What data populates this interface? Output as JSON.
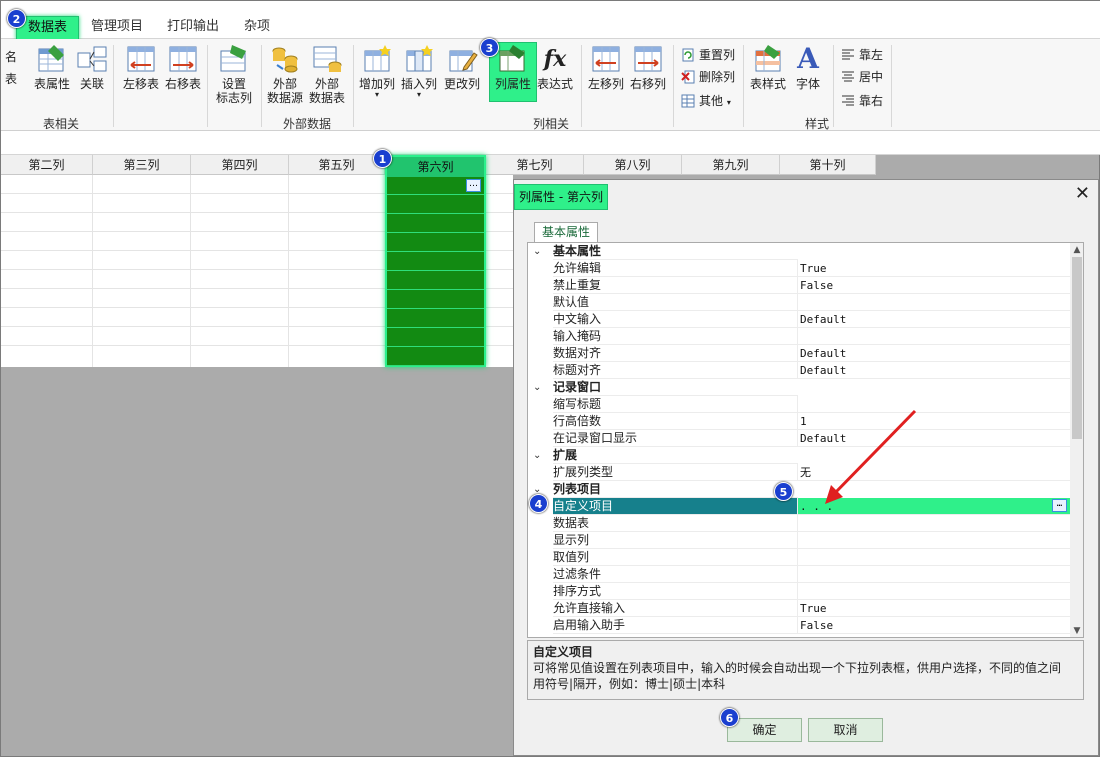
{
  "ribbon_tabs": [
    "数据表",
    "管理项目",
    "打印输出",
    "杂项"
  ],
  "left_partial": [
    "名",
    "表"
  ],
  "groups": {
    "table": "表相关",
    "external": "外部数据",
    "column": "列相关",
    "style": "样式"
  },
  "buttons": {
    "table_props": "表属性",
    "relation": "关联",
    "move_left": "左移表",
    "move_right": "右移表",
    "set_flag_line1": "设置",
    "set_flag_line2": "标志列",
    "ext_source_line1": "外部",
    "ext_source_line2": "数据源",
    "ext_table_line1": "外部",
    "ext_table_line2": "数据表",
    "add_col": "增加列",
    "insert_col": "插入列",
    "change_col": "更改列",
    "col_props": "列属性",
    "expression": "表达式",
    "col_left": "左移列",
    "col_right": "右移列",
    "reset_col": "重置列",
    "delete_col": "删除列",
    "other": "其他",
    "table_style": "表样式",
    "font": "字体",
    "align_left": "靠左",
    "align_center": "居中",
    "align_right": "靠右"
  },
  "columns": [
    "第二列",
    "第三列",
    "第四列",
    "第五列",
    "第六列",
    "第七列",
    "第八列",
    "第九列",
    "第十列"
  ],
  "dialog": {
    "title": "列属性 - 第六列",
    "tab": "基本属性",
    "categories": [
      "基本属性",
      "记录窗口",
      "扩展",
      "列表项目"
    ],
    "rows": [
      {
        "name": "基本属性",
        "value": "",
        "cat": true
      },
      {
        "name": "允许编辑",
        "value": "True"
      },
      {
        "name": "禁止重复",
        "value": "False"
      },
      {
        "name": "默认值",
        "value": ""
      },
      {
        "name": "中文输入",
        "value": "Default"
      },
      {
        "name": "输入掩码",
        "value": ""
      },
      {
        "name": "数据对齐",
        "value": "Default"
      },
      {
        "name": "标题对齐",
        "value": "Default"
      },
      {
        "name": "记录窗口",
        "value": "",
        "cat": true
      },
      {
        "name": "缩写标题",
        "value": ""
      },
      {
        "name": "行高倍数",
        "value": "1"
      },
      {
        "name": "在记录窗口显示",
        "value": "Default"
      },
      {
        "name": "扩展",
        "value": "",
        "cat": true
      },
      {
        "name": "扩展列类型",
        "value": "无"
      },
      {
        "name": "列表项目",
        "value": "",
        "cat": true
      },
      {
        "name": "自定义项目",
        "value": ". . .",
        "hl": true
      },
      {
        "name": "数据表",
        "value": ""
      },
      {
        "name": "显示列",
        "value": ""
      },
      {
        "name": "取值列",
        "value": ""
      },
      {
        "name": "过滤条件",
        "value": ""
      },
      {
        "name": "排序方式",
        "value": ""
      },
      {
        "name": "允许直接输入",
        "value": "True"
      },
      {
        "name": "启用输入助手",
        "value": "False"
      }
    ],
    "desc_title": "自定义项目",
    "desc_line1": "可将常见值设置在列表项目中，输入的时候会自动出现一个下拉列表框，供用户选择，不同的值之间",
    "desc_line2": "用符号|隔开，例如：博士|硕士|本科",
    "ok": "确定",
    "cancel": "取消"
  },
  "badges": [
    "1",
    "2",
    "3",
    "4",
    "5",
    "6"
  ],
  "colors": {
    "highlight": "#2ff08a",
    "selected_col": "#128a12",
    "badge": "#1a3fcf",
    "arrow": "#e02020"
  }
}
